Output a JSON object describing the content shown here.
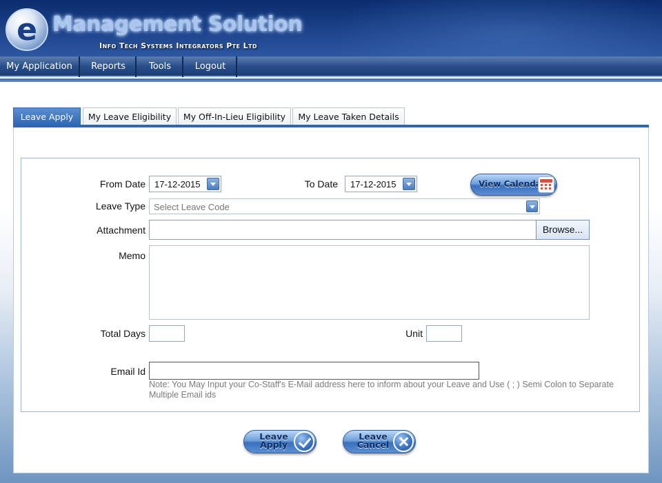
{
  "header": {
    "logo_letter": "e",
    "title": "Management Solution",
    "subtitle": "Info Tech Systems Integrators Pte Ltd"
  },
  "menu": {
    "items": [
      {
        "label": "My Application"
      },
      {
        "label": "Reports"
      },
      {
        "label": "Tools"
      },
      {
        "label": "Logout"
      }
    ]
  },
  "tabs": [
    {
      "label": "Leave Apply",
      "active": true
    },
    {
      "label": "My Leave Eligibility",
      "active": false
    },
    {
      "label": "My Off-In-Lieu Eligibility",
      "active": false
    },
    {
      "label": "My Leave Taken Details",
      "active": false
    }
  ],
  "form": {
    "from_date_label": "From Date",
    "from_date_value": "17-12-2015",
    "to_date_label": "To Date",
    "to_date_value": "17-12-2015",
    "view_calendar_label": "View Calendar",
    "leave_type_label": "Leave Type",
    "leave_type_placeholder": "Select Leave Code",
    "attachment_label": "Attachment",
    "browse_label": "Browse...",
    "memo_label": "Memo",
    "memo_value": "",
    "total_days_label": "Total Days",
    "total_days_value": "",
    "unit_label": "Unit",
    "unit_value": "",
    "email_label": "Email Id",
    "email_value": "",
    "email_note": "Note: You May Input your Co-Staff's E-Mail address here to inform about your Leave and Use ( ; ) Semi Colon to Separate Multiple Email ids"
  },
  "actions": {
    "apply_line1": "Leave",
    "apply_line2": "Apply",
    "cancel_line1": "Leave",
    "cancel_line2": "Cancel"
  },
  "icons": {
    "calendar": "calendar-icon",
    "dropdown": "chevron-down-icon",
    "apply": "check-icon",
    "cancel": "close-icon"
  },
  "colors": {
    "header_bg": "#1a3f86",
    "tab_active": "#2f66b3",
    "form_border": "#9db4e6",
    "note_text": "#7b7b7b"
  }
}
